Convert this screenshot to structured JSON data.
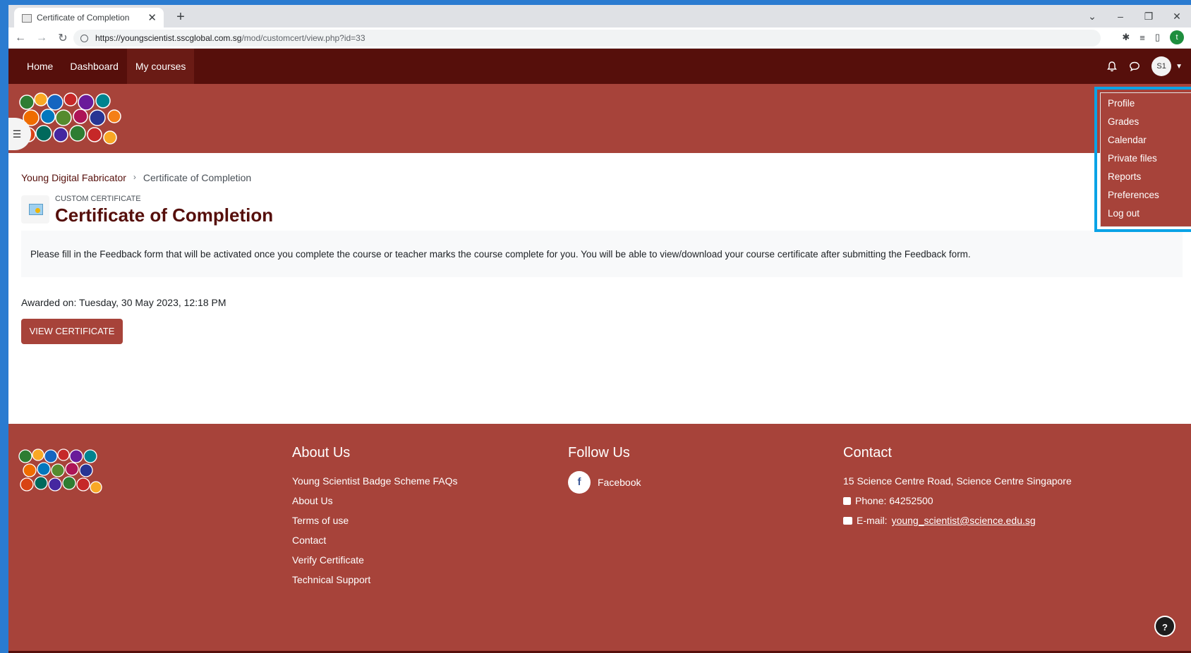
{
  "browser": {
    "tab_title": "Certificate of Completion",
    "tab_close": "✕",
    "new_tab": "+",
    "url_host": "https://youngscientist.sscglobal.com.sg",
    "url_path": "/mod/customcert/view.php?id=33",
    "profile_initial": "t"
  },
  "navbar": {
    "home": "Home",
    "dashboard": "Dashboard",
    "my_courses": "My courses",
    "avatar_initials": "S1"
  },
  "user_menu": {
    "items": [
      "Profile",
      "Grades",
      "Calendar",
      "Private files",
      "Reports",
      "Preferences",
      "Log out"
    ]
  },
  "breadcrumb": {
    "course": "Young Digital Fabricator",
    "separator": "›",
    "current": "Certificate of Completion"
  },
  "page": {
    "module_type": "Custom certificate",
    "title": "Certificate of Completion",
    "notice": "Please fill in the Feedback form that will be activated once you complete the course or teacher marks the course complete for you. You will be able to view/download your course certificate after submitting the Feedback form.",
    "awarded": "Awarded on: Tuesday, 30 May 2023, 12:18 PM",
    "view_button": "View certificate"
  },
  "footer": {
    "about_heading": "About Us",
    "about_links": [
      "Young Scientist Badge Scheme FAQs",
      "About Us",
      "Terms of use",
      "Contact",
      "Verify Certificate",
      "Technical Support"
    ],
    "follow_heading": "Follow Us",
    "facebook": "Facebook",
    "contact_heading": "Contact",
    "address": "15 Science Centre Road, Science Centre Singapore",
    "phone": "Phone: 64252500",
    "email_label": "E-mail:",
    "email": "young_scientist@science.edu.sg",
    "help": "?"
  },
  "colors": {
    "navbar": "#560f0b",
    "banner": "#a7433a",
    "highlight": "#0aa3e6"
  }
}
